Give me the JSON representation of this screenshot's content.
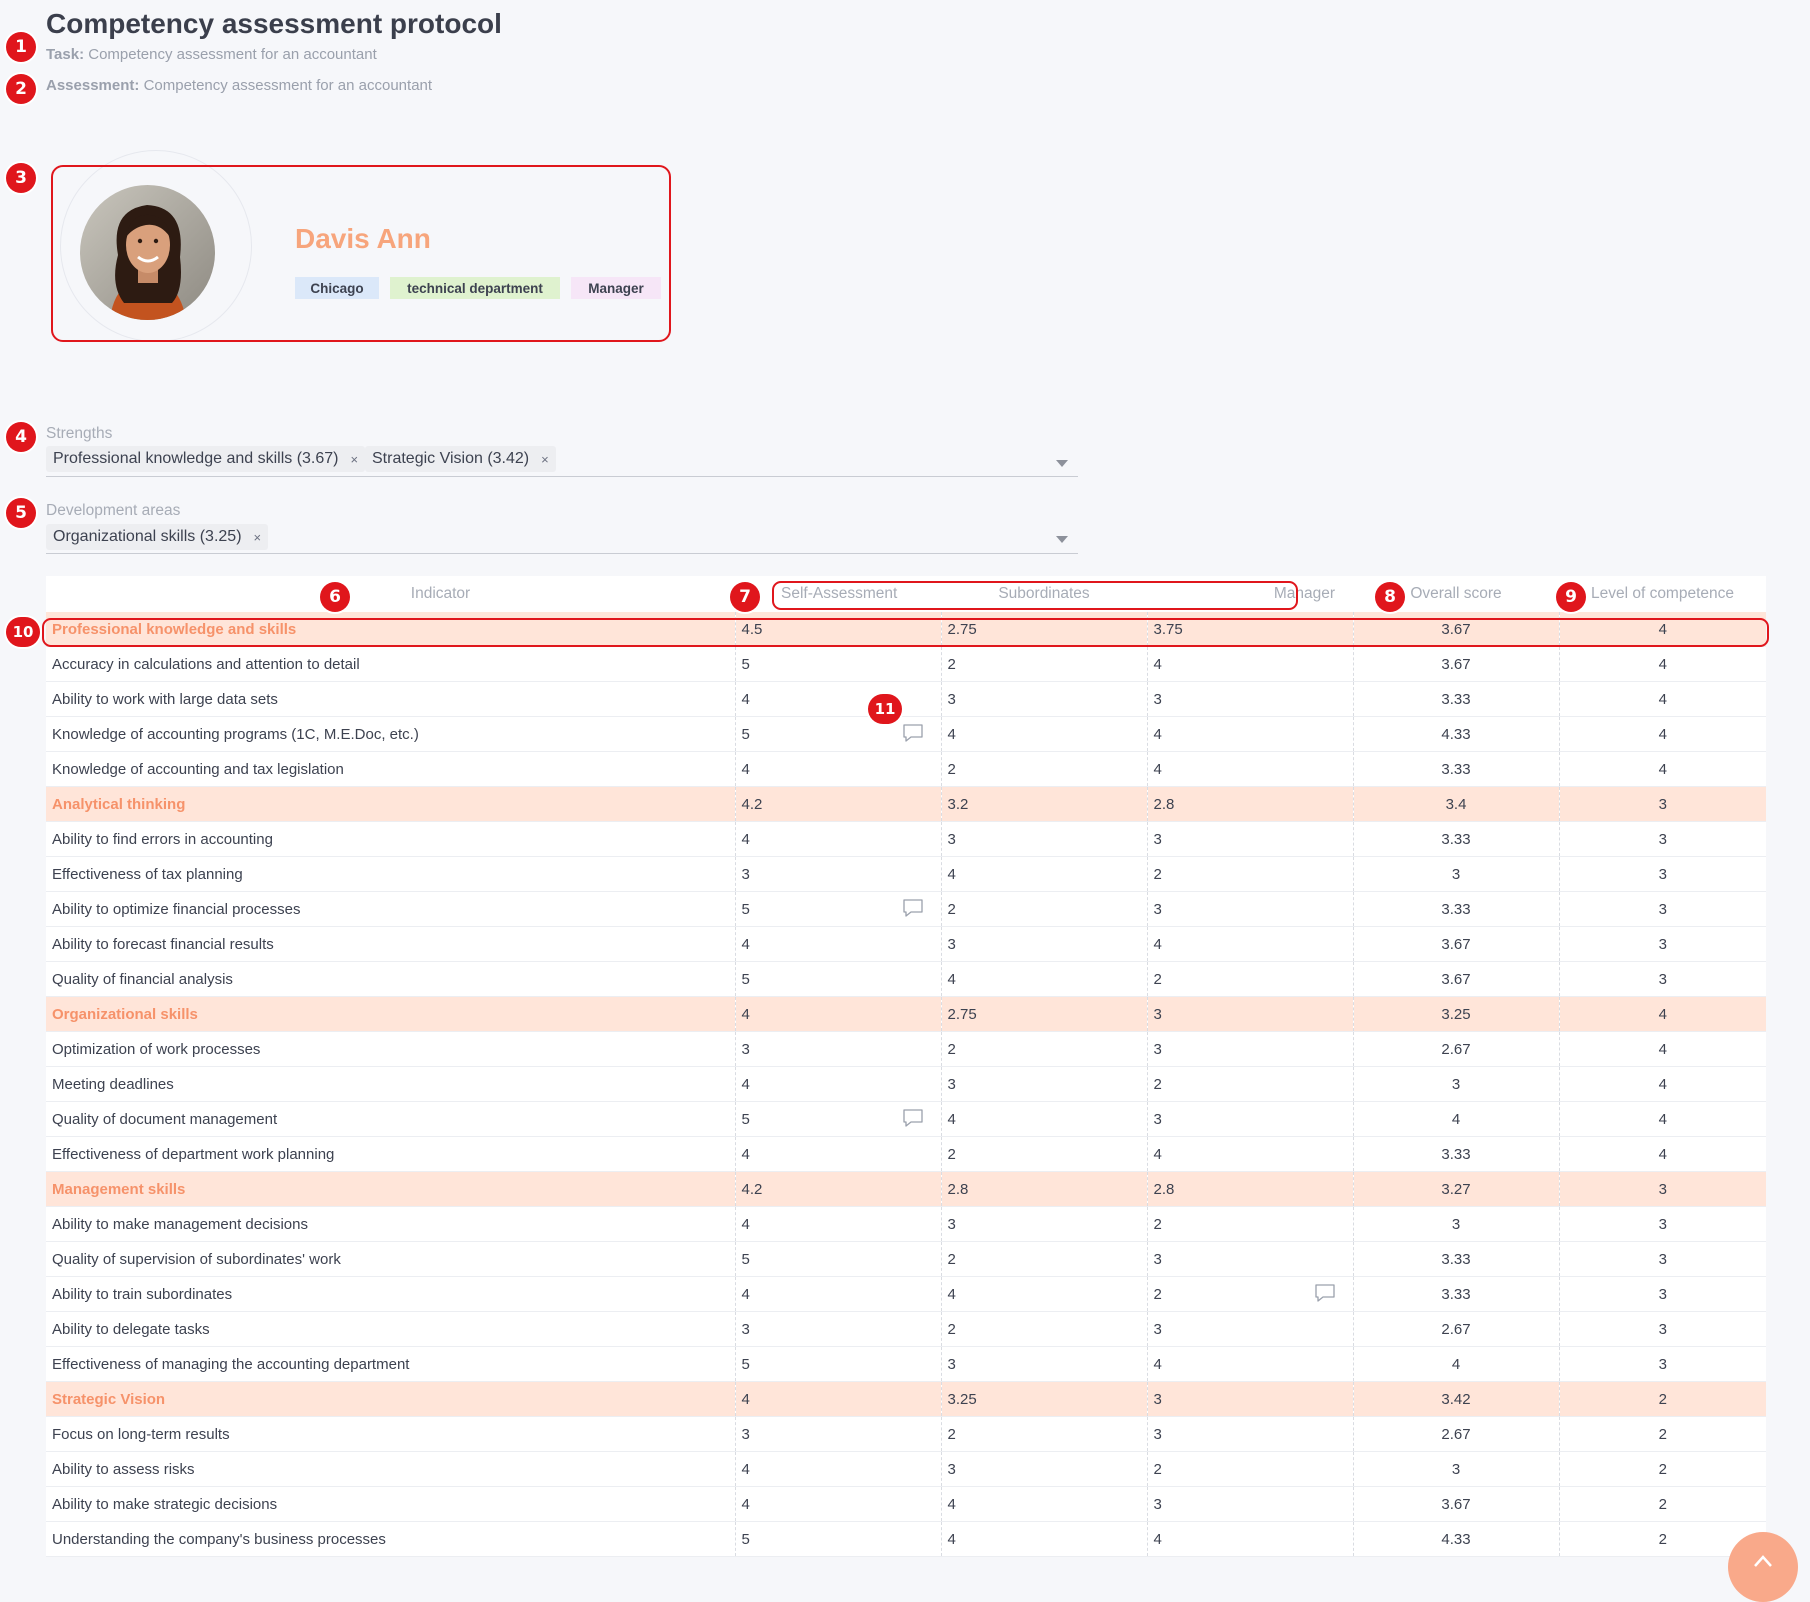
{
  "header": {
    "title": "Competency assessment protocol",
    "task_label": "Task:",
    "task_value": "Competency assessment for an accountant",
    "assessment_label": "Assessment:",
    "assessment_value": "Competency assessment for an accountant"
  },
  "profile": {
    "name": "Davis Ann",
    "tags": [
      {
        "label": "Chicago",
        "color": "#dbe8f9"
      },
      {
        "label": "technical department",
        "color": "#dff2cf"
      },
      {
        "label": "Manager",
        "color": "#f6e6f7"
      }
    ]
  },
  "strengths": {
    "label": "Strengths",
    "items": [
      "Professional knowledge and skills (3.67)",
      "Strategic Vision (3.42)"
    ]
  },
  "development": {
    "label": "Development areas",
    "items": [
      "Organizational skills (3.25)"
    ]
  },
  "remove_glyph": "×",
  "markers": [
    "1",
    "2",
    "3",
    "4",
    "5",
    "6",
    "7",
    "8",
    "9",
    "10",
    "11"
  ],
  "table": {
    "headers": {
      "indicator": "Indicator",
      "self": "Self-Assessment",
      "subordinates": "Subordinates",
      "manager": "Manager",
      "overall": "Overall score",
      "level": "Level of competence"
    },
    "rows": [
      {
        "name": "Professional knowledge and skills",
        "self": "4.5",
        "sub": "2.75",
        "mgr": "3.75",
        "overall": "3.67",
        "level": "4",
        "group": true
      },
      {
        "name": "Accuracy in calculations and attention to detail",
        "self": "5",
        "sub": "2",
        "mgr": "4",
        "overall": "3.67",
        "level": "4"
      },
      {
        "name": "Ability to work with large data sets",
        "self": "4",
        "sub": "3",
        "mgr": "3",
        "overall": "3.33",
        "level": "4"
      },
      {
        "name": "Knowledge of accounting programs (1C, M.E.Doc, etc.)",
        "self": "5",
        "sub": "4",
        "mgr": "4",
        "overall": "4.33",
        "level": "4",
        "comment": "self"
      },
      {
        "name": "Knowledge of accounting and tax legislation",
        "self": "4",
        "sub": "2",
        "mgr": "4",
        "overall": "3.33",
        "level": "4"
      },
      {
        "name": "Analytical thinking",
        "self": "4.2",
        "sub": "3.2",
        "mgr": "2.8",
        "overall": "3.4",
        "level": "3",
        "group": true
      },
      {
        "name": "Ability to find errors in accounting",
        "self": "4",
        "sub": "3",
        "mgr": "3",
        "overall": "3.33",
        "level": "3"
      },
      {
        "name": "Effectiveness of tax planning",
        "self": "3",
        "sub": "4",
        "mgr": "2",
        "overall": "3",
        "level": "3"
      },
      {
        "name": "Ability to optimize financial processes",
        "self": "5",
        "sub": "2",
        "mgr": "3",
        "overall": "3.33",
        "level": "3",
        "comment": "self"
      },
      {
        "name": "Ability to forecast financial results",
        "self": "4",
        "sub": "3",
        "mgr": "4",
        "overall": "3.67",
        "level": "3"
      },
      {
        "name": "Quality of financial analysis",
        "self": "5",
        "sub": "4",
        "mgr": "2",
        "overall": "3.67",
        "level": "3"
      },
      {
        "name": "Organizational skills",
        "self": "4",
        "sub": "2.75",
        "mgr": "3",
        "overall": "3.25",
        "level": "4",
        "group": true
      },
      {
        "name": "Optimization of work processes",
        "self": "3",
        "sub": "2",
        "mgr": "3",
        "overall": "2.67",
        "level": "4"
      },
      {
        "name": "Meeting deadlines",
        "self": "4",
        "sub": "3",
        "mgr": "2",
        "overall": "3",
        "level": "4"
      },
      {
        "name": "Quality of document management",
        "self": "5",
        "sub": "4",
        "mgr": "3",
        "overall": "4",
        "level": "4",
        "comment": "self"
      },
      {
        "name": "Effectiveness of department work planning",
        "self": "4",
        "sub": "2",
        "mgr": "4",
        "overall": "3.33",
        "level": "4"
      },
      {
        "name": "Management skills",
        "self": "4.2",
        "sub": "2.8",
        "mgr": "2.8",
        "overall": "3.27",
        "level": "3",
        "group": true
      },
      {
        "name": "Ability to make management decisions",
        "self": "4",
        "sub": "3",
        "mgr": "2",
        "overall": "3",
        "level": "3"
      },
      {
        "name": "Quality of supervision of subordinates' work",
        "self": "5",
        "sub": "2",
        "mgr": "3",
        "overall": "3.33",
        "level": "3"
      },
      {
        "name": "Ability to train subordinates",
        "self": "4",
        "sub": "4",
        "mgr": "2",
        "overall": "3.33",
        "level": "3",
        "comment": "mgr"
      },
      {
        "name": "Ability to delegate tasks",
        "self": "3",
        "sub": "2",
        "mgr": "3",
        "overall": "2.67",
        "level": "3"
      },
      {
        "name": "Effectiveness of managing the accounting department",
        "self": "5",
        "sub": "3",
        "mgr": "4",
        "overall": "4",
        "level": "3"
      },
      {
        "name": "Strategic Vision",
        "self": "4",
        "sub": "3.25",
        "mgr": "3",
        "overall": "3.42",
        "level": "2",
        "group": true
      },
      {
        "name": "Focus on long-term results",
        "self": "3",
        "sub": "2",
        "mgr": "3",
        "overall": "2.67",
        "level": "2"
      },
      {
        "name": "Ability to assess risks",
        "self": "4",
        "sub": "3",
        "mgr": "2",
        "overall": "3",
        "level": "2"
      },
      {
        "name": "Ability to make strategic decisions",
        "self": "4",
        "sub": "4",
        "mgr": "3",
        "overall": "3.67",
        "level": "2"
      },
      {
        "name": "Understanding the company's business processes",
        "self": "5",
        "sub": "4",
        "mgr": "4",
        "overall": "4.33",
        "level": "2"
      }
    ]
  },
  "colors": {
    "accent": "#f6926a",
    "group_bg": "#ffe5d9",
    "marker": "#e0161c",
    "fab": "#f9a98a"
  }
}
